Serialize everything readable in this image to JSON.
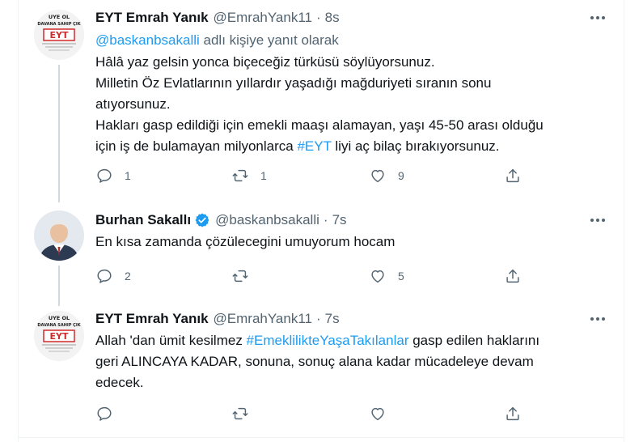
{
  "tweets": [
    {
      "name": "EYT Emrah Yanık",
      "handle": "@EmrahYank11",
      "time": "8s",
      "reply_prefix": "@baskanbsakalli",
      "reply_suffix": " adlı kişiye yanıt olarak",
      "text_lines": [
        "Hâlâ yaz gelsin yonca biçeceğiz türküsü söylüyorsunuz.",
        "Milletin Öz Evlatlarının yıllardır yaşadığı mağduriyeti sıranın sonu",
        "atıyorsunuz.",
        "Hakları gasp edildiği için emekli maaşı alamayan, yaşı 45-50 arası olduğu",
        "için iş de bulamayan milyonlarca "
      ],
      "hashtag": "#EYT",
      "text_tail": " liyi aç bilaç bırakıyorsunuz.",
      "replies": "1",
      "retweets": "1",
      "likes": "9",
      "avatar_text": {
        "top": "UYE OL",
        "mid": "DAVANA SAHIP ÇIK",
        "logo": "EYT"
      }
    },
    {
      "name": "Burhan Sakallı",
      "handle": "@baskanbsakalli",
      "time": "7s",
      "text": "En kısa zamanda çözülecegini umuyorum hocam",
      "replies": "2",
      "retweets": "",
      "likes": "5"
    },
    {
      "name": "EYT Emrah Yanık",
      "handle": "@EmrahYank11",
      "time": "7s",
      "text_pre": "Allah 'dan ümit kesilmez ",
      "hashtag": "#EmeklilikteYaşaTakılanlar",
      "text_line1_tail": " gasp edilen haklarını",
      "text_line2": "geri ALINCAYA KADAR, sonuna, sonuç alana kadar mücadeleye devam",
      "text_line3": "edecek.",
      "replies": "",
      "retweets": "",
      "likes": "",
      "avatar_text": {
        "top": "UYE OL",
        "mid": "DAVANA SAHIP ÇIK",
        "logo": "EYT"
      }
    }
  ],
  "icons": {
    "reply": "reply-icon",
    "retweet": "retweet-icon",
    "like": "heart-icon",
    "share": "share-icon",
    "more": "more-icon",
    "verified": "verified-badge-icon"
  },
  "colors": {
    "accent": "#1d9bf0",
    "secondary_text": "#536471",
    "primary_text": "#0f1419",
    "logo_red": "#d22b2b"
  },
  "dot": "·"
}
